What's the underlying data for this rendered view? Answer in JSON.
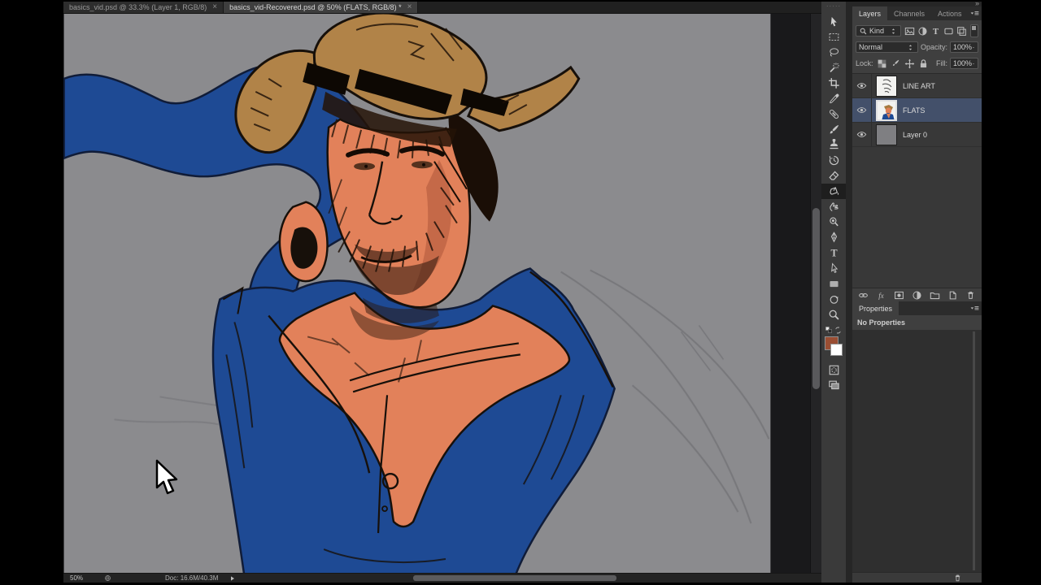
{
  "window": {
    "document_tabs": [
      {
        "label": "basics_vid.psd @ 33.3% (Layer 1, RGB/8)",
        "close_label": "×",
        "active": false
      },
      {
        "label": "basics_vid-Recovered.psd @ 50% (FLATS, RGB/8) *",
        "close_label": "×",
        "active": true
      }
    ]
  },
  "toolbar": {
    "tools": [
      {
        "name": "move-tool",
        "icon": "move",
        "selected": false
      },
      {
        "name": "rectangular-marquee-tool",
        "icon": "marquee",
        "selected": false
      },
      {
        "name": "lasso-tool",
        "icon": "lasso",
        "selected": false
      },
      {
        "name": "magic-wand-tool",
        "icon": "wand",
        "selected": false
      },
      {
        "name": "crop-tool",
        "icon": "crop",
        "selected": false
      },
      {
        "name": "eyedropper-tool",
        "icon": "eyedrop",
        "selected": false
      },
      {
        "name": "healing-brush-tool",
        "icon": "heal",
        "selected": false
      },
      {
        "name": "brush-tool",
        "icon": "brush",
        "selected": false
      },
      {
        "name": "clone-stamp-tool",
        "icon": "stamp",
        "selected": false
      },
      {
        "name": "history-brush-tool",
        "icon": "history",
        "selected": false
      },
      {
        "name": "eraser-tool",
        "icon": "eraser",
        "selected": false
      },
      {
        "name": "paint-bucket-tool",
        "icon": "bucket",
        "selected": true
      },
      {
        "name": "smudge-tool",
        "icon": "smudge",
        "selected": false
      },
      {
        "name": "dodge-tool",
        "icon": "dodge",
        "selected": false
      },
      {
        "name": "pen-tool",
        "icon": "pen",
        "selected": false
      },
      {
        "name": "type-tool",
        "icon": "typeT",
        "selected": false
      },
      {
        "name": "path-selection-tool",
        "icon": "pathsel",
        "selected": false
      },
      {
        "name": "shape-tool",
        "icon": "shape",
        "selected": false
      },
      {
        "name": "rotate-view-tool",
        "icon": "rotate",
        "selected": false
      },
      {
        "name": "zoom-tool",
        "icon": "zoom",
        "selected": false
      }
    ],
    "foreground_color": "#9a4e33",
    "background_color": "#ffffff"
  },
  "layers_panel": {
    "tabs": [
      {
        "label": "Layers",
        "active": true
      },
      {
        "label": "Channels",
        "active": false
      },
      {
        "label": "Actions",
        "active": false
      }
    ],
    "filter_label": "Kind",
    "filter_icons": [
      "picture",
      "halfcircle",
      "typeT",
      "shapes",
      "smartobj"
    ],
    "blend_mode": "Normal",
    "opacity_label": "Opacity:",
    "opacity_value": "100%",
    "lock_label": "Lock:",
    "lock_icons": [
      "checker",
      "brushsm",
      "movecross",
      "padlock"
    ],
    "fill_label": "Fill:",
    "fill_value": "100%",
    "layers": [
      {
        "name": "LINE ART",
        "thumb": "lineart",
        "selected": false,
        "visible": true
      },
      {
        "name": "FLATS",
        "thumb": "flats",
        "selected": true,
        "visible": true
      },
      {
        "name": "Layer 0",
        "thumb": "gray",
        "selected": false,
        "visible": true
      }
    ],
    "footer_icons": [
      "link",
      "fx",
      "masksm",
      "halfcircle",
      "folder",
      "newlayer",
      "trash"
    ],
    "selected_row_color": "#43506a"
  },
  "properties_panel": {
    "tab_label": "Properties",
    "empty_message": "No Properties"
  },
  "status_bar": {
    "zoom_level": "50%",
    "doc_info": "Doc: 16.6M/40.3M"
  },
  "canvas": {
    "colors": {
      "background": "#8b8b8e",
      "skin": "#e2815a",
      "skin_shadow": "#b25a3c",
      "shirt": "#1e4a94",
      "ribbon": "#1e4a94",
      "hat": "#b18348",
      "ink": "#17100a",
      "pasteboard": "#19191b"
    }
  }
}
